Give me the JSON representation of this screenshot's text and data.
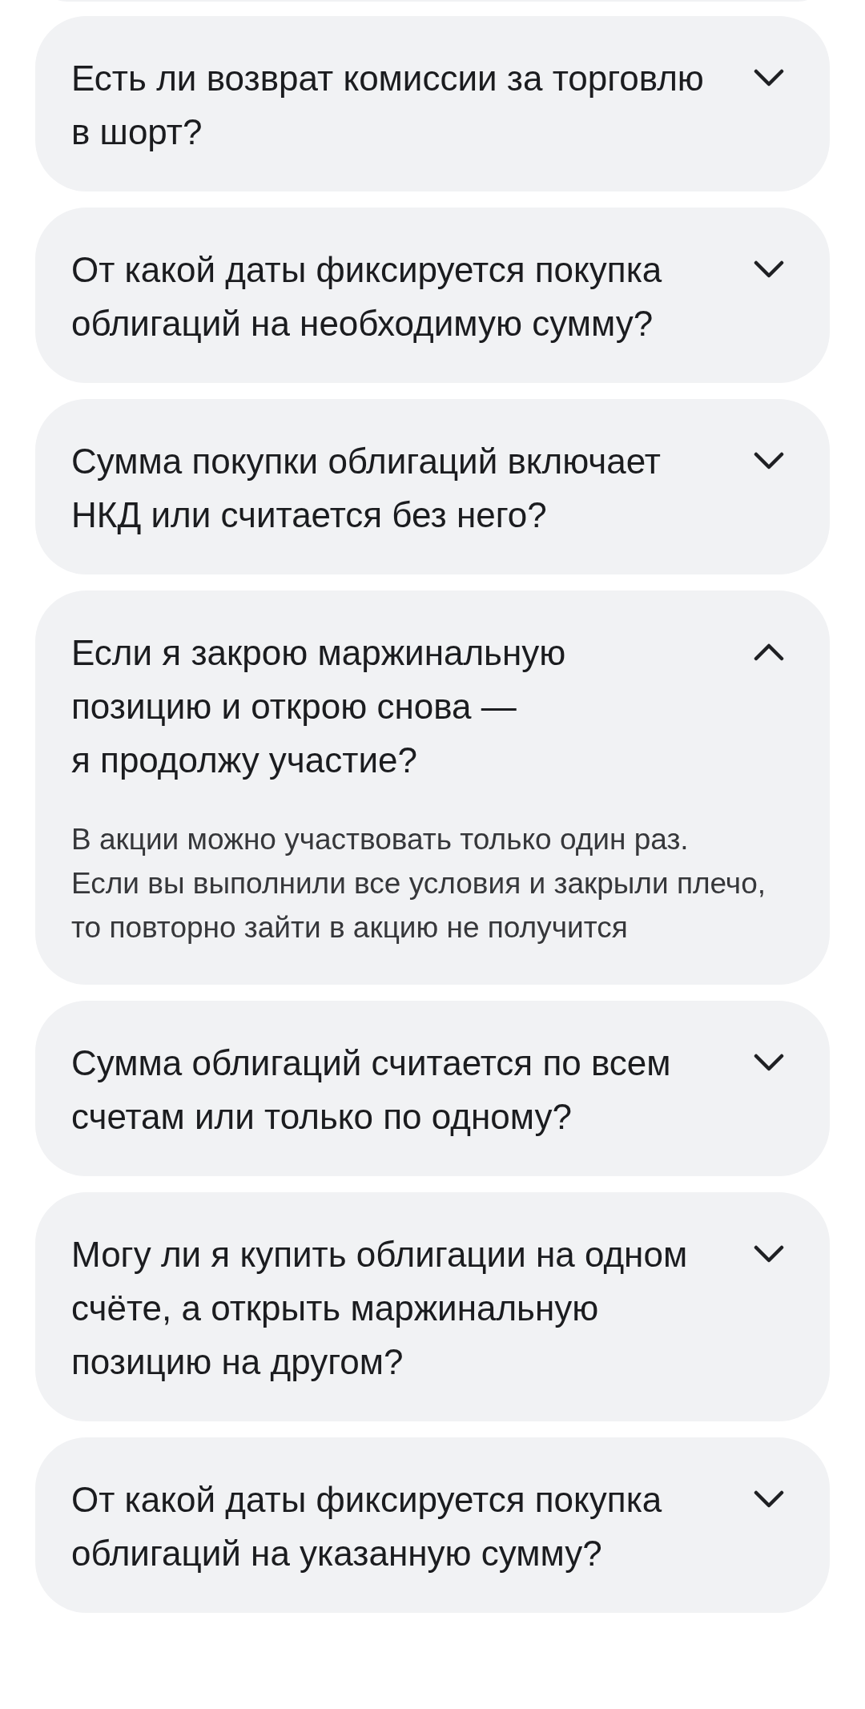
{
  "faq": [
    {
      "question": "Есть ли возврат комиссии за торговлю\nв шорт?",
      "expanded": false
    },
    {
      "question": "От какой даты фиксируется покупка\nоблигаций на необходимую сумму?",
      "expanded": false
    },
    {
      "question": "Сумма покупки облигаций включает\nНКД или считается без него?",
      "expanded": false
    },
    {
      "question": "Если я закрою маржинальную\nпозицию и открою снова —\nя продолжу участие?",
      "expanded": true,
      "answer": "В акции можно участвовать только один раз.\nЕсли вы выполнили все условия и закрыли плечо,\nто повторно зайти в акцию не получится"
    },
    {
      "question": "Сумма облигаций считается по всем\nсчетам или только по одному?",
      "expanded": false
    },
    {
      "question": "Могу ли я купить облигации на одном\nсчёте, а открыть маржинальную\nпозицию на другом?",
      "expanded": false
    },
    {
      "question": "От какой даты фиксируется покупка\nоблигаций на указанную сумму?",
      "expanded": false
    }
  ]
}
